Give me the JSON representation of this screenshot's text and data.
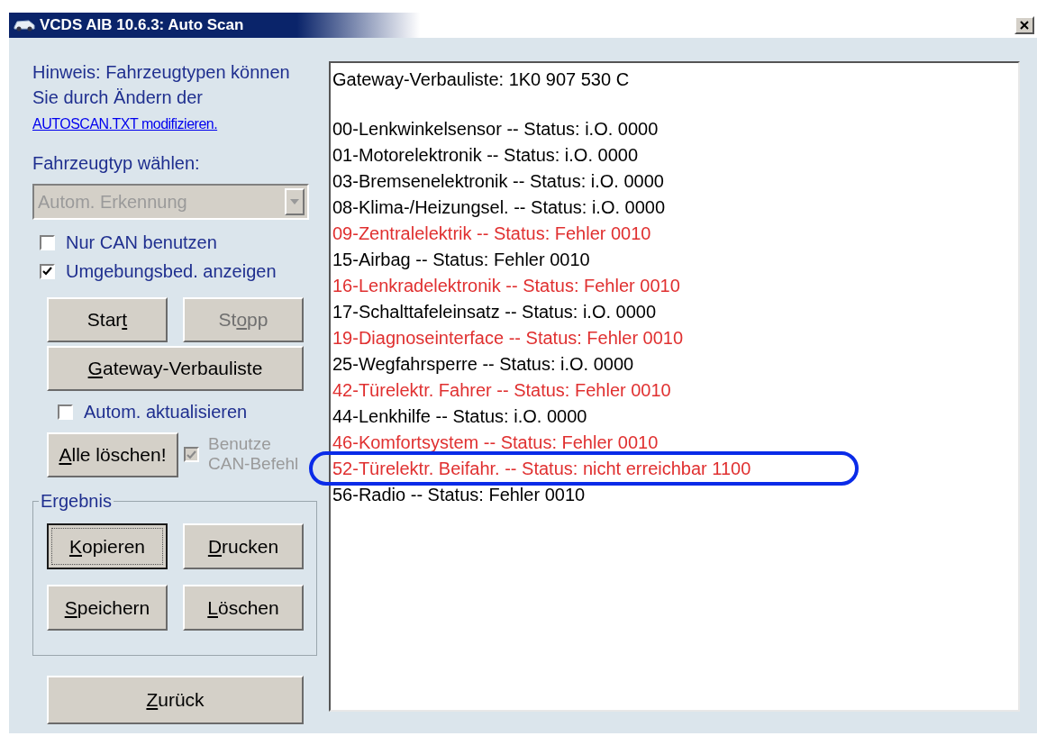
{
  "window": {
    "title": "VCDS AIB 10.6.3: Auto Scan"
  },
  "hint": {
    "text": "Hinweis: Fahrzeugtypen können Sie durch Ändern der",
    "link": "AUTOSCAN.TXT modifizieren."
  },
  "vehicle_type": {
    "label": "Fahrzeugtyp wählen:",
    "value": "Autom. Erkennung",
    "disabled": true
  },
  "options": [
    {
      "label": "Nur CAN benutzen",
      "checked": false,
      "disabled": false
    },
    {
      "label": "Umgebungsbed. anzeigen",
      "checked": true,
      "disabled": false
    }
  ],
  "scan_buttons": [
    {
      "pre": "Star",
      "key": "t",
      "disabled": false
    },
    {
      "pre": "St",
      "key": "o",
      "post": "pp",
      "disabled": true
    }
  ],
  "gateway_button": {
    "key": "G",
    "post": "ateway-Verbauliste",
    "disabled": false
  },
  "auto_update": {
    "label": "Autom. aktualisieren",
    "checked": false,
    "disabled": false
  },
  "clear_all_button": {
    "key": "A",
    "post": "lle löschen!",
    "disabled": false
  },
  "can_commands": {
    "label_lines": [
      "Benutze",
      "CAN-Befehl"
    ],
    "checked": true,
    "disabled": true
  },
  "result_group": {
    "title": "Ergebnis",
    "buttons": [
      {
        "key": "K",
        "post": "opieren",
        "disabled": false,
        "focused": true
      },
      {
        "key": "D",
        "post": "rucken",
        "disabled": false,
        "focused": false
      },
      {
        "key": "S",
        "post": "peichern",
        "disabled": false,
        "focused": false
      },
      {
        "key": "L",
        "post": "öschen",
        "disabled": false,
        "focused": false
      }
    ]
  },
  "back_button": {
    "key": "Z",
    "post": "urück",
    "disabled": false
  },
  "output": {
    "header": "Gateway-Verbauliste:  1K0 907 530 C",
    "lines": [
      {
        "text": "00-Lenkwinkelsensor -- Status: i.O. 0000",
        "error": false
      },
      {
        "text": "01-Motorelektronik -- Status: i.O. 0000",
        "error": false
      },
      {
        "text": "03-Bremsenelektronik -- Status: i.O. 0000",
        "error": false
      },
      {
        "text": "08-Klima-/Heizungsel. -- Status: i.O. 0000",
        "error": false
      },
      {
        "text": "09-Zentralelektrik -- Status: Fehler 0010",
        "error": true
      },
      {
        "text": "15-Airbag -- Status: Fehler 0010",
        "error": false
      },
      {
        "text": "16-Lenkradelektronik -- Status: Fehler 0010",
        "error": true
      },
      {
        "text": "17-Schalttafeleinsatz -- Status: i.O. 0000",
        "error": false
      },
      {
        "text": "19-Diagnoseinterface -- Status: Fehler 0010",
        "error": true
      },
      {
        "text": "25-Wegfahrsperre -- Status: i.O. 0000",
        "error": false
      },
      {
        "text": "42-Türelektr. Fahrer -- Status: Fehler 0010",
        "error": true
      },
      {
        "text": "44-Lenkhilfe -- Status: i.O. 0000",
        "error": false
      },
      {
        "text": "46-Komfortsystem -- Status: Fehler 0010",
        "error": true
      },
      {
        "text": "52-Türelektr. Beifahr. -- Status: nicht erreichbar 1100",
        "error": true
      },
      {
        "text": "56-Radio -- Status: Fehler 0010",
        "error": false
      }
    ]
  }
}
